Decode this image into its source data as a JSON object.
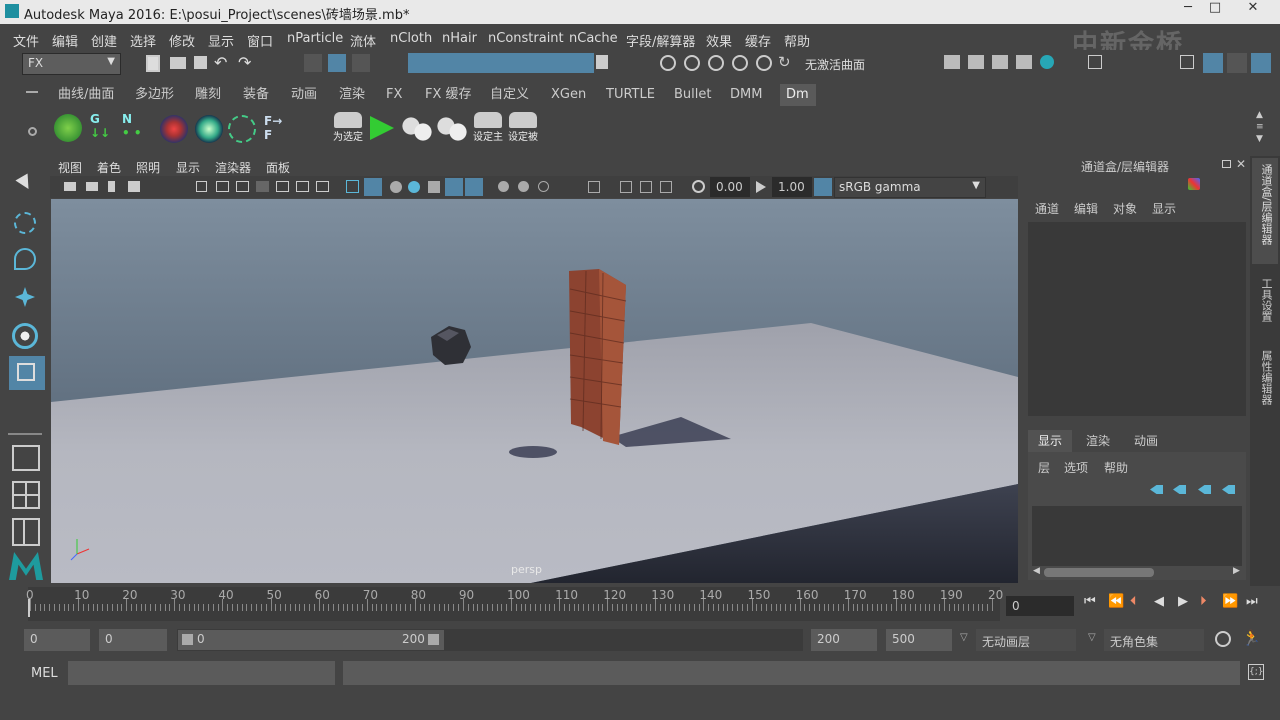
{
  "window": {
    "title": "Autodesk Maya 2016: E:\\posui_Project\\scenes\\砖墙场景.mb*",
    "minimize": "─",
    "maximize": "□",
    "close": "✕"
  },
  "menu": [
    "文件",
    "编辑",
    "创建",
    "选择",
    "修改",
    "显示",
    "窗口",
    "nParticle",
    "流体",
    "nCloth",
    "nHair",
    "nConstraint",
    "nCache",
    "字段/解算器",
    "效果",
    "缓存",
    "帮助"
  ],
  "toolbar": {
    "menu_set": "FX",
    "no_live_surface": "无激活曲面"
  },
  "shelf_tabs": [
    "曲线/曲面",
    "多边形",
    "雕刻",
    "装备",
    "动画",
    "渲染",
    "FX",
    "FX 缓存",
    "自定义",
    "XGen",
    "TURTLE",
    "Bullet",
    "DMM",
    "Dm"
  ],
  "shelf_active": "Dm",
  "shelf_buttons": {
    "set_selected": "为选定",
    "set_main": "设定主",
    "set_passive": "设定被"
  },
  "viewport": {
    "menu": [
      "视图",
      "着色",
      "照明",
      "显示",
      "渲染器",
      "面板"
    ],
    "exposure": "0.00",
    "gamma": "1.00",
    "color_space": "sRGB gamma",
    "camera_label": "persp"
  },
  "channel_box": {
    "title": "通道盒/层编辑器",
    "menu": [
      "通道",
      "编辑",
      "对象",
      "显示"
    ]
  },
  "layer_editor": {
    "tabs": [
      "显示",
      "渲染",
      "动画"
    ],
    "active_tab": "显示",
    "menu": [
      "层",
      "选项",
      "帮助"
    ]
  },
  "side_tabs": [
    "通道盒/层编辑器",
    "工具设置",
    "属性编辑器"
  ],
  "timeline": {
    "ticks": [
      "0",
      "10",
      "20",
      "30",
      "40",
      "50",
      "60",
      "70",
      "80",
      "90",
      "100",
      "110",
      "120",
      "130",
      "140",
      "150",
      "160",
      "170",
      "180",
      "190",
      "20"
    ],
    "current_frame": "0"
  },
  "range": {
    "start": "0",
    "playback_start": "0",
    "range_start": "0",
    "range_end": "200",
    "playback_end": "200",
    "end": "500",
    "anim_layer": "无动画层",
    "char_set": "无角色集"
  },
  "command": {
    "label": "MEL"
  },
  "watermark": "中新金桥",
  "colors": {
    "bg": "#444444",
    "accent": "#5285a6",
    "wall": "#9a4a32",
    "floor": "#b4b6bf"
  }
}
